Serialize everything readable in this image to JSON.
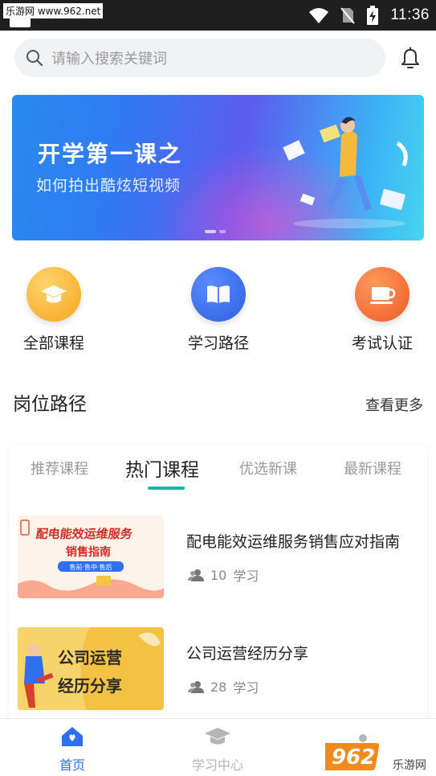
{
  "status_bar": {
    "watermark": "乐游网 www.962.net",
    "time": "11:36",
    "icons": [
      "wifi-icon",
      "no-sim-icon",
      "battery-charging-icon"
    ]
  },
  "search": {
    "placeholder": "请输入搜索关键词",
    "icon": "search-icon"
  },
  "header": {
    "bell_icon": "bell-icon"
  },
  "banner": {
    "title": "开学第一课之",
    "subtitle": "如何拍出酷炫短视频",
    "pages": 2,
    "active_page": 1
  },
  "quick_menu": [
    {
      "label": "全部课程",
      "icon": "graduation-cap-icon",
      "color": "#f5a623"
    },
    {
      "label": "学习路径",
      "icon": "open-book-icon",
      "color": "#2f6ff0"
    },
    {
      "label": "考试认证",
      "icon": "cup-icon",
      "color": "#f0622d"
    }
  ],
  "section": {
    "title": "岗位路径",
    "more": "查看更多"
  },
  "tabs": [
    {
      "label": "推荐课程",
      "active": false
    },
    {
      "label": "热门课程",
      "active": true
    },
    {
      "label": "优选新课",
      "active": false
    },
    {
      "label": "最新课程",
      "active": false
    }
  ],
  "courses": [
    {
      "title": "配电能效运维服务销售应对指南",
      "learners": "10",
      "learners_suffix": "学习",
      "thumb_title_1": "配电能效运维服务",
      "thumb_title_2": "销售指南",
      "thumb_tag": "售前·售中·售后"
    },
    {
      "title": "公司运营经历分享",
      "learners": "28",
      "learners_suffix": "学习",
      "thumb_title_1": "公司运营",
      "thumb_title_2": "经历分享"
    }
  ],
  "bottom_nav": [
    {
      "label": "首页",
      "icon": "home-icon",
      "active": true
    },
    {
      "label": "学习中心",
      "icon": "graduation-cap-icon",
      "active": false
    }
  ],
  "footer_watermark": {
    "text": "962.NET",
    "subtext": "乐游网"
  },
  "colors": {
    "accent": "#1fb2a6",
    "nav_active": "#2f6ff0",
    "nav_inactive": "#b5b5b5"
  }
}
